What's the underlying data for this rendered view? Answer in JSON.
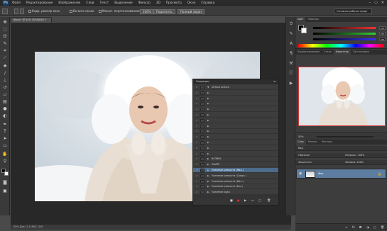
{
  "app": {
    "logo": "Ps",
    "window_controls": [
      "–",
      "▭",
      "✕"
    ]
  },
  "menu": [
    "Файл",
    "Редактирование",
    "Изображение",
    "Слои",
    "Текст",
    "Выделение",
    "Фильтр",
    "3D",
    "Просмотр",
    "Окно",
    "Справка"
  ],
  "options": {
    "resize_label": "Кадр. размер окон",
    "all_windows_label": "Во всех окнах",
    "scrubby_label": "Масшт. перетаскиванием",
    "percent_btn": "100%",
    "fit_btn": "Подогнать",
    "fill_btn": "Полный экран",
    "workspace": "Основная рабочая среда"
  },
  "document": {
    "tab": "Фрукт @ 50% (RGB/8#) *",
    "status": "50%   Док: 2,11M/2,11M"
  },
  "actions": {
    "title": "Операции",
    "rows": [
      {
        "label": "Default Actions",
        "tri": "▼",
        "sel": false
      },
      {
        "label": "",
        "tri": "▶",
        "sel": false
      },
      {
        "label": "",
        "tri": "▶",
        "sel": false
      },
      {
        "label": "",
        "tri": "▶",
        "sel": false
      },
      {
        "label": "",
        "tri": "▶",
        "sel": false
      },
      {
        "label": "",
        "tri": "▶",
        "sel": false
      },
      {
        "label": "",
        "tri": "▶",
        "sel": false
      },
      {
        "label": "",
        "tri": "▶",
        "sel": false
      },
      {
        "label": "",
        "tri": "▶",
        "sel": false
      },
      {
        "label": "",
        "tri": "▶",
        "sel": false
      },
      {
        "label": "",
        "tri": "▶",
        "sel": false
      },
      {
        "label": "",
        "tri": "▶",
        "sel": false
      },
      {
        "label": "",
        "tri": "▶",
        "sel": false
      },
      {
        "label": "ВОЗВРА",
        "tri": "▶",
        "sel": false
      },
      {
        "label": "SAVEB",
        "tri": "▶",
        "sel": false
      },
      {
        "label": "Усиление резкости (Мал.)",
        "tri": "▶",
        "sel": true
      },
      {
        "label": "Усиление резкости (Средн.)",
        "tri": "▶",
        "sel": false
      },
      {
        "label": "Усиление резкости (Мал.)",
        "tri": "▶",
        "sel": false
      },
      {
        "label": "Усиление резкости (Бол.)",
        "tri": "▶",
        "sel": false
      },
      {
        "label": "Усиление края",
        "tri": "▶",
        "sel": false
      }
    ],
    "footer_icons": [
      "■",
      "●",
      "▶",
      "▭",
      "▢",
      "🗑"
    ]
  },
  "color": {
    "tabs": [
      "Цвет",
      "Образцы"
    ],
    "values": [
      "255",
      "255",
      "255"
    ],
    "colors": {
      "r": "#d33",
      "g": "#3b3",
      "b": "#33d"
    }
  },
  "navigator": {
    "tabs": [
      "Корректирование",
      "Стили",
      "Навигатор",
      "Гистограмма"
    ],
    "zoom": "50%"
  },
  "layers": {
    "tabs": [
      "Слои",
      "Каналы",
      "Контуры"
    ],
    "kind": "Вид",
    "mode": "Обычные",
    "opacity_label": "Непрозр.: 100%",
    "lock_label": "Закрепить:",
    "fill_label": "Заливка: 100%",
    "layer_name": "Фон",
    "lock_icon": "🔒"
  },
  "icons": [
    "move-icon",
    "marquee-icon",
    "lasso-icon",
    "quick-select-icon",
    "crop-icon",
    "eyedropper-icon",
    "heal-icon",
    "brush-icon",
    "stamp-icon",
    "history-brush-icon",
    "eraser-icon",
    "gradient-icon",
    "blur-icon",
    "dodge-icon",
    "pen-icon",
    "type-icon",
    "path-select-icon",
    "shape-icon",
    "hand-icon",
    "zoom-icon"
  ]
}
